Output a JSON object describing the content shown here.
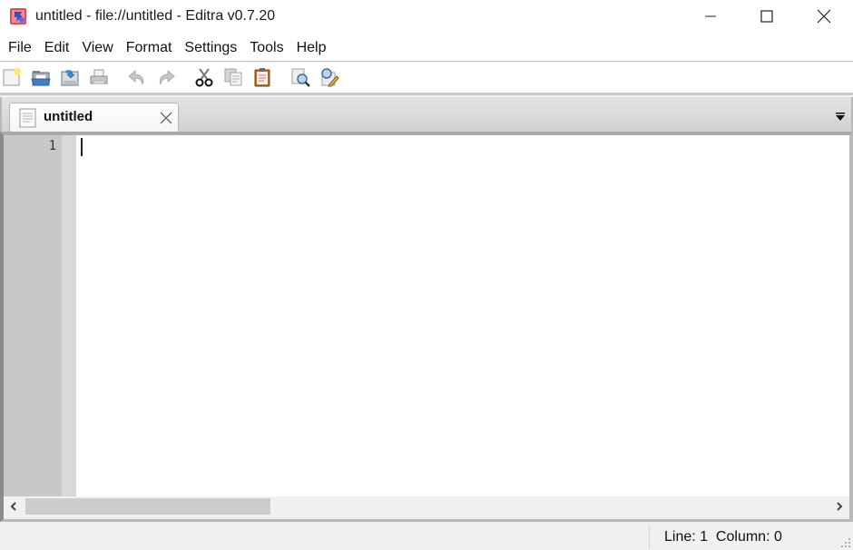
{
  "window": {
    "title": "untitled - file://untitled - Editra v0.7.20",
    "app_icon": "editra-app-icon",
    "controls": {
      "minimize": "minimize-icon",
      "maximize": "maximize-icon",
      "close": "close-icon"
    }
  },
  "menubar": {
    "items": [
      {
        "label": "File"
      },
      {
        "label": "Edit"
      },
      {
        "label": "View"
      },
      {
        "label": "Format"
      },
      {
        "label": "Settings"
      },
      {
        "label": "Tools"
      },
      {
        "label": "Help"
      }
    ]
  },
  "toolbar": {
    "buttons": [
      {
        "name": "new-file",
        "icon": "new-document-icon",
        "enabled": true
      },
      {
        "name": "open-file",
        "icon": "open-folder-icon",
        "enabled": true
      },
      {
        "name": "save-file",
        "icon": "save-icon",
        "enabled": true
      },
      {
        "name": "print",
        "icon": "printer-icon",
        "enabled": false
      },
      {
        "name": "undo",
        "icon": "undo-icon",
        "enabled": false
      },
      {
        "name": "redo",
        "icon": "redo-icon",
        "enabled": false
      },
      {
        "name": "cut",
        "icon": "scissors-icon",
        "enabled": true
      },
      {
        "name": "copy",
        "icon": "copy-icon",
        "enabled": false
      },
      {
        "name": "paste",
        "icon": "clipboard-icon",
        "enabled": true
      },
      {
        "name": "find",
        "icon": "find-icon",
        "enabled": true
      },
      {
        "name": "find-replace",
        "icon": "find-replace-icon",
        "enabled": true
      }
    ]
  },
  "tabs": {
    "items": [
      {
        "label": "untitled",
        "active": true,
        "icon": "document-icon"
      }
    ],
    "menu_icon": "tab-menu-dropdown-icon"
  },
  "editor": {
    "line_numbers": [
      "1"
    ],
    "content": ""
  },
  "statusbar": {
    "position": "Line: 1  Column: 0"
  },
  "colors": {
    "gutter": "#c8c8c8",
    "fold_margin": "#d9d9d9",
    "editor_bg": "#ffffff",
    "chrome_bg": "#f0f0f0"
  }
}
